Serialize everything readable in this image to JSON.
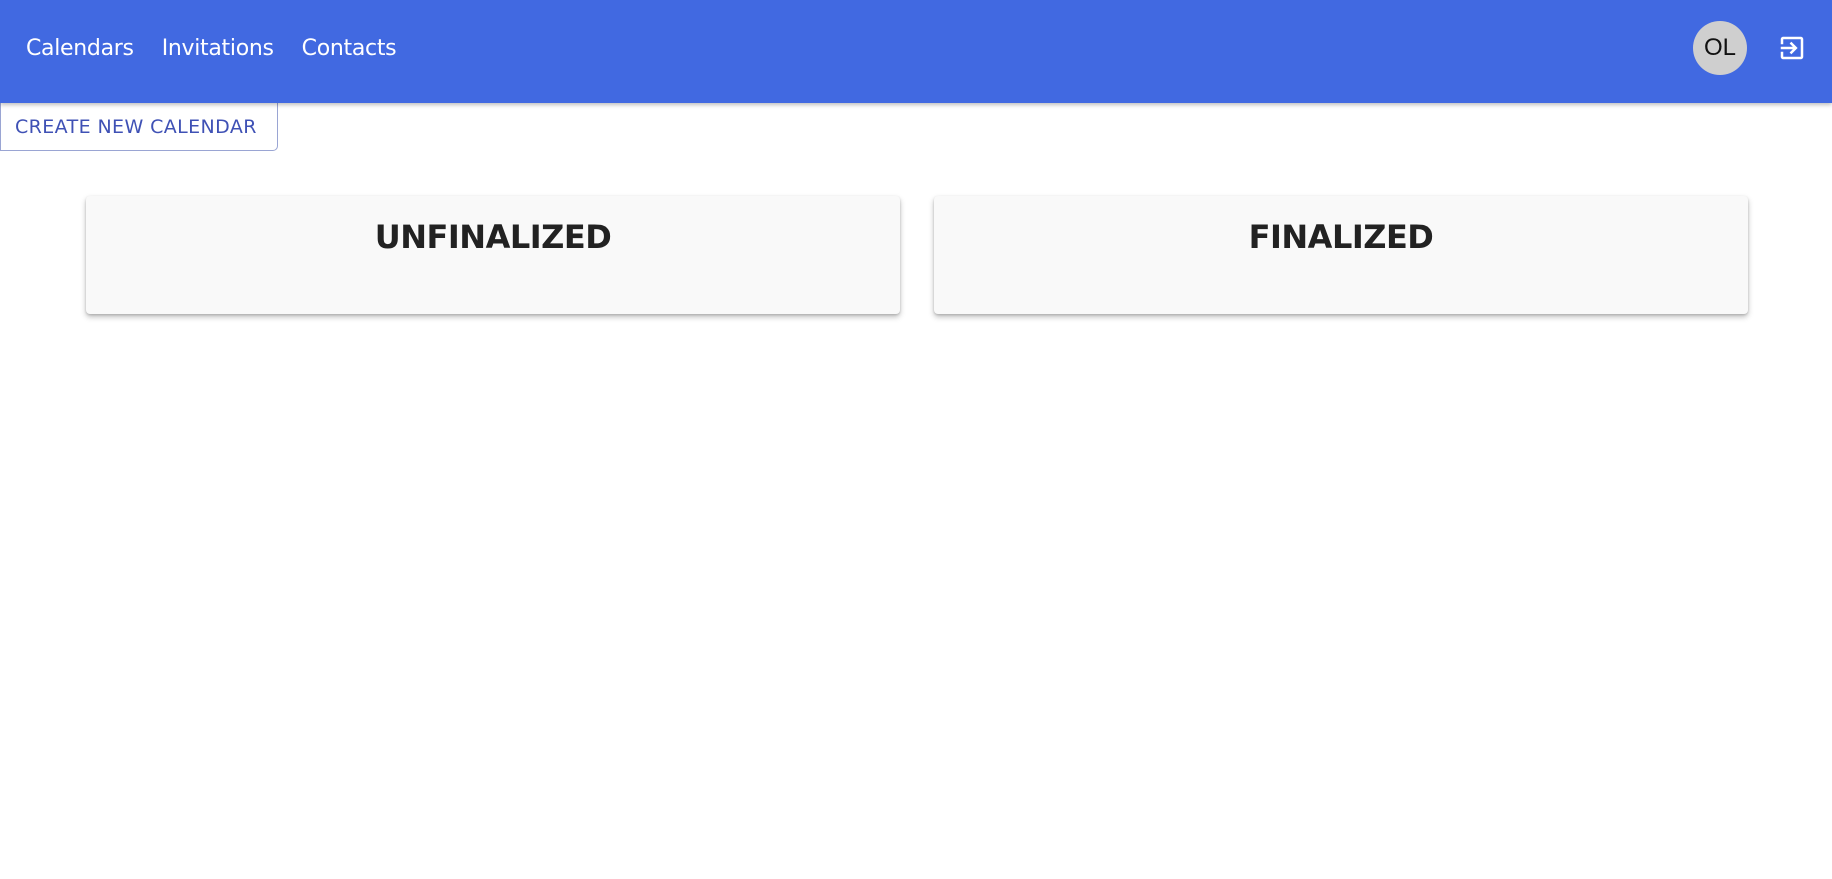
{
  "nav": {
    "items": [
      {
        "label": "Calendars"
      },
      {
        "label": "Invitations"
      },
      {
        "label": "Contacts"
      }
    ]
  },
  "user": {
    "initials": "OL"
  },
  "icons": {
    "logout": "logout-icon"
  },
  "actions": {
    "create_calendar_label": "CREATE NEW CALENDAR"
  },
  "sections": [
    {
      "title": "UNFINALIZED"
    },
    {
      "title": "FINALIZED"
    }
  ],
  "colors": {
    "header": "#4169e1",
    "button_text": "#3f51b5",
    "card_bg": "#f9f9f9"
  }
}
